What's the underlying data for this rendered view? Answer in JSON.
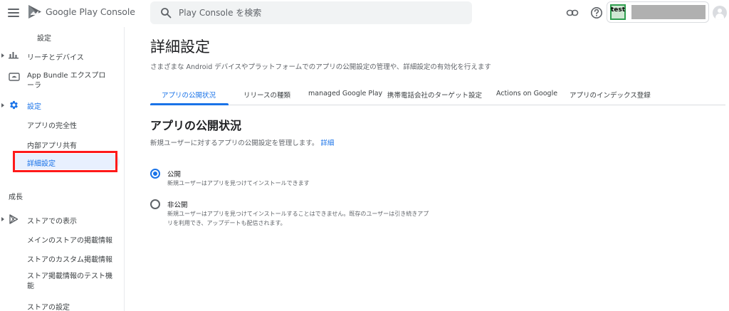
{
  "header": {
    "brand": "Google Play Console",
    "search_placeholder": "Play Console を検索",
    "account_label": "test"
  },
  "sidebar": {
    "items": [
      {
        "label": "設定"
      },
      {
        "label": "リーチとデバイス"
      },
      {
        "label": "App Bundle エクスプローラ"
      },
      {
        "label": "設定"
      },
      {
        "label": "アプリの完全性"
      },
      {
        "label": "内部アプリ共有"
      },
      {
        "label": "詳細設定"
      }
    ],
    "section_growth": "成長",
    "growth_items": [
      {
        "label": "ストアでの表示"
      },
      {
        "label": "メインのストアの掲載情報"
      },
      {
        "label": "ストアのカスタム掲載情報"
      },
      {
        "label": "ストア掲載情報のテスト機能"
      },
      {
        "label": "ストアの設定"
      }
    ]
  },
  "main": {
    "title": "詳細設定",
    "description": "さまざまな Android デバイスやプラットフォームでのアプリの公開設定の管理や、詳細設定の有効化を行えます",
    "tabs": [
      {
        "label": "アプリの公開状況"
      },
      {
        "label": "リリースの種類"
      },
      {
        "label": "managed Google Play"
      },
      {
        "label": "携帯電話会社のターゲット設定"
      },
      {
        "label": "Actions on Google"
      },
      {
        "label": "アプリのインデックス登録"
      }
    ],
    "section_title": "アプリの公開状況",
    "section_desc": "新規ユーザーに対するアプリの公開設定を管理します。",
    "learn_more": "詳細",
    "options": [
      {
        "label": "公開",
        "desc": "新規ユーザーはアプリを見つけてインストールできます",
        "checked": true
      },
      {
        "label": "非公開",
        "desc_line1": "新規ユーザーはアプリを見つけてインストールすることはできません。既存のユーザーは引き続きアプ",
        "desc_line2": "リを利用でき、アップデートも配信されます。",
        "checked": false
      }
    ]
  },
  "colors": {
    "accent": "#1a73e8",
    "highlight": "#ff1a1a"
  }
}
